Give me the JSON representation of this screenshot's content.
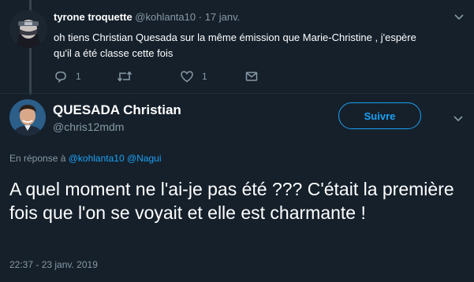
{
  "reply_tweet": {
    "name": "tyrone troquette",
    "handle": "@kohlanta10",
    "separator": "·",
    "date": "17 janv.",
    "text": "oh tiens Christian Quesada sur la même émission que Marie-Christine , j'espère qu'il a été classe cette fois",
    "actions": {
      "reply_count": "1",
      "retweet_count": "",
      "like_count": "1"
    }
  },
  "main_tweet": {
    "name": "QUESADA Christian",
    "handle": "@chris12mdm",
    "follow_label": "Suivre",
    "reply_prefix": "En réponse à",
    "reply_mention_1": "@kohlanta10",
    "reply_mention_2": "@Nagui",
    "text": "A quel moment ne l'ai-je pas été ??? C'était la première fois que l'on se voyait et elle est charmante !",
    "timestamp": "22:37 - 23 janv. 2019"
  },
  "colors": {
    "background": "#15202b",
    "accent": "#1da1f2",
    "muted": "#8899a6"
  },
  "icons": [
    "reply-icon",
    "retweet-icon",
    "like-icon",
    "direct-message-icon",
    "caret-down-icon"
  ]
}
